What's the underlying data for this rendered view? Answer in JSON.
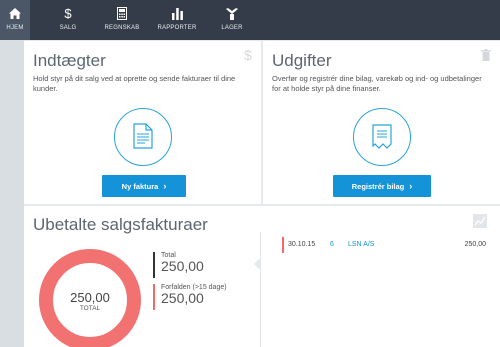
{
  "nav": {
    "items": [
      {
        "label": "HJEM",
        "icon": "home-icon"
      },
      {
        "label": "SALG",
        "icon": "dollar-icon"
      },
      {
        "label": "REGNSKAB",
        "icon": "calculator-icon"
      },
      {
        "label": "RAPPORTER",
        "icon": "bar-chart-icon"
      },
      {
        "label": "LAGER",
        "icon": "inventory-icon"
      }
    ]
  },
  "income": {
    "title": "Indtægter",
    "description": "Hold styr på dit salg ved at oprette og sende fakturaer til dine kunder.",
    "button": "Ny faktura",
    "corner_icon": "dollar-icon"
  },
  "expenses": {
    "title": "Udgifter",
    "description": "Overfør og registrér dine bilag, varekøb og ind- og udbetalinger for at holde styr på dine finanser.",
    "button": "Registrér bilag",
    "corner_icon": "trash-icon"
  },
  "unpaid": {
    "title": "Ubetalte salgsfakturaer",
    "donut_value": "250,00",
    "donut_label": "TOTAL",
    "total_label": "Total",
    "total_value": "250,00",
    "overdue_label": "Forfalden (>15 dage)",
    "overdue_value": "250,00",
    "overdue_fraction": 1.0,
    "invoices": [
      {
        "date": "30.10.15",
        "number": "6",
        "customer": "LSN A/S",
        "amount": "250,00"
      }
    ]
  },
  "colors": {
    "nav_bg": "#343c49",
    "accent": "#1493d9",
    "overdue": "#f16b6b"
  }
}
